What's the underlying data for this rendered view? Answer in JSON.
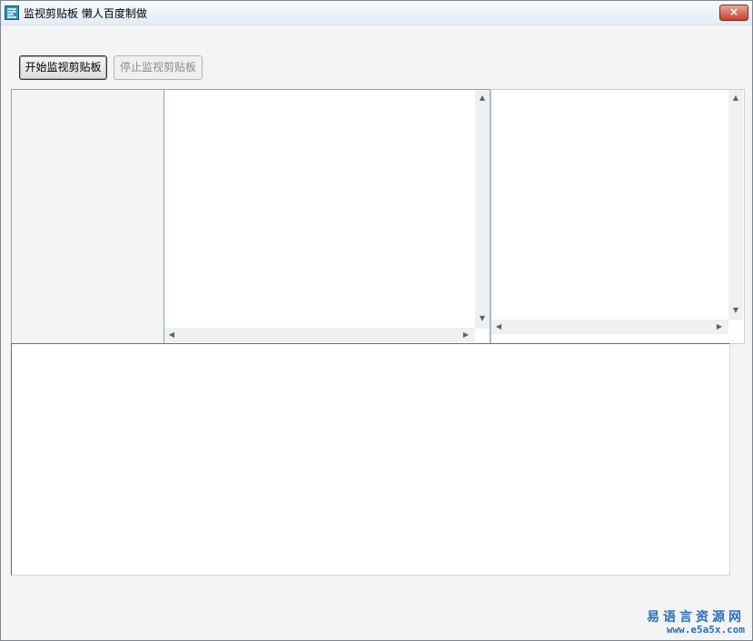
{
  "window": {
    "title": "监视剪贴板    懒人百度制做",
    "close_label": "×"
  },
  "toolbar": {
    "start_label": "开始监视剪贴板",
    "stop_label": "停止监视剪贴板"
  },
  "watermark": {
    "site_name": "易语言资源网",
    "url": "www.e5a5x.com"
  }
}
